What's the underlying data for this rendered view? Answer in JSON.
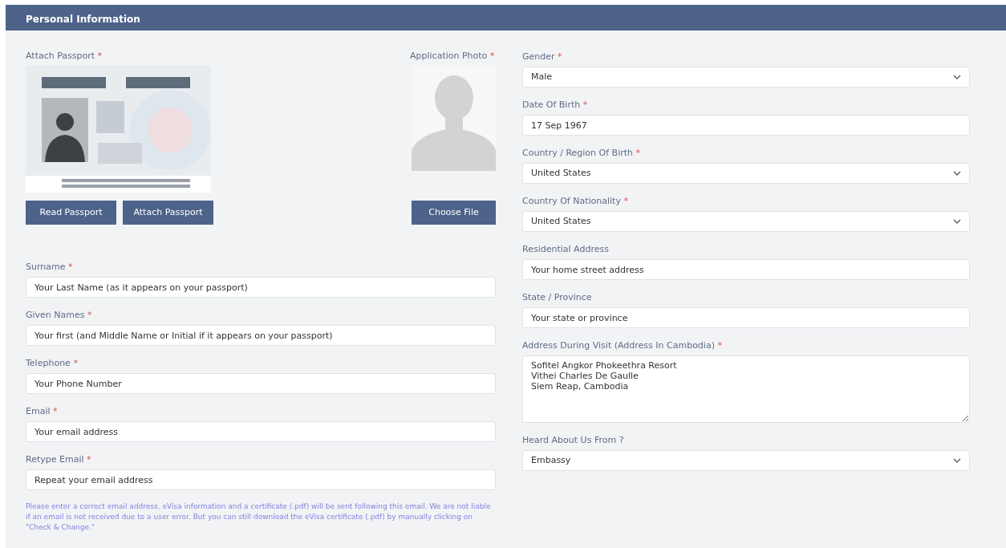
{
  "header": {
    "title": "Personal Information"
  },
  "required_mark": "*",
  "passport": {
    "label": "Attach Passport",
    "required": true,
    "buttons": [
      "Read Passport",
      "Attach Passport"
    ]
  },
  "photo": {
    "label": "Application Photo",
    "required": true,
    "button": "Choose File"
  },
  "left_fields": [
    {
      "label": "Surname",
      "required": true,
      "kind": "input",
      "placeholder": "Your Last Name (as it appears on your passport)"
    },
    {
      "label": "Given Names",
      "required": true,
      "kind": "input",
      "placeholder": "Your first (and Middle Name or Initial if it appears on your passport)"
    },
    {
      "label": "Telephone",
      "required": true,
      "kind": "input",
      "placeholder": "Your Phone Number"
    },
    {
      "label": "Email",
      "required": true,
      "kind": "input",
      "placeholder": "Your email address"
    },
    {
      "label": "Retype Email",
      "required": true,
      "kind": "input",
      "placeholder": "Repeat your email address"
    }
  ],
  "note": "Please enter a correct email address. eVisa information and a certificate (.pdf) will be sent following this email. We are not liable if an email is not received due to a user error. But you can still download the eVisa certificate (.pdf) by manually clicking on \"Check & Change.\"",
  "right_fields": [
    {
      "label": "Gender",
      "required": true,
      "kind": "select",
      "value": "Male"
    },
    {
      "label": "Date Of Birth",
      "required": true,
      "kind": "input",
      "value": "17 Sep 1967"
    },
    {
      "label": "Country / Region Of Birth",
      "required": true,
      "kind": "select",
      "value": "United States"
    },
    {
      "label": "Country Of Nationality",
      "required": true,
      "kind": "select",
      "value": "United States"
    },
    {
      "label": "Residential Address",
      "required": false,
      "kind": "input",
      "placeholder": "Your home street address"
    },
    {
      "label": "State / Province",
      "required": false,
      "kind": "input",
      "placeholder": "Your state or province"
    },
    {
      "label": "Address During Visit (Address In Cambodia)",
      "required": true,
      "kind": "textarea",
      "value": "Sofitel Angkor Phokeethra Resort\nVithei Charles De Gaulle\nSiem Reap, Cambodia"
    },
    {
      "label": "Heard About Us From ?",
      "required": false,
      "kind": "select",
      "value": "Embassy"
    }
  ]
}
